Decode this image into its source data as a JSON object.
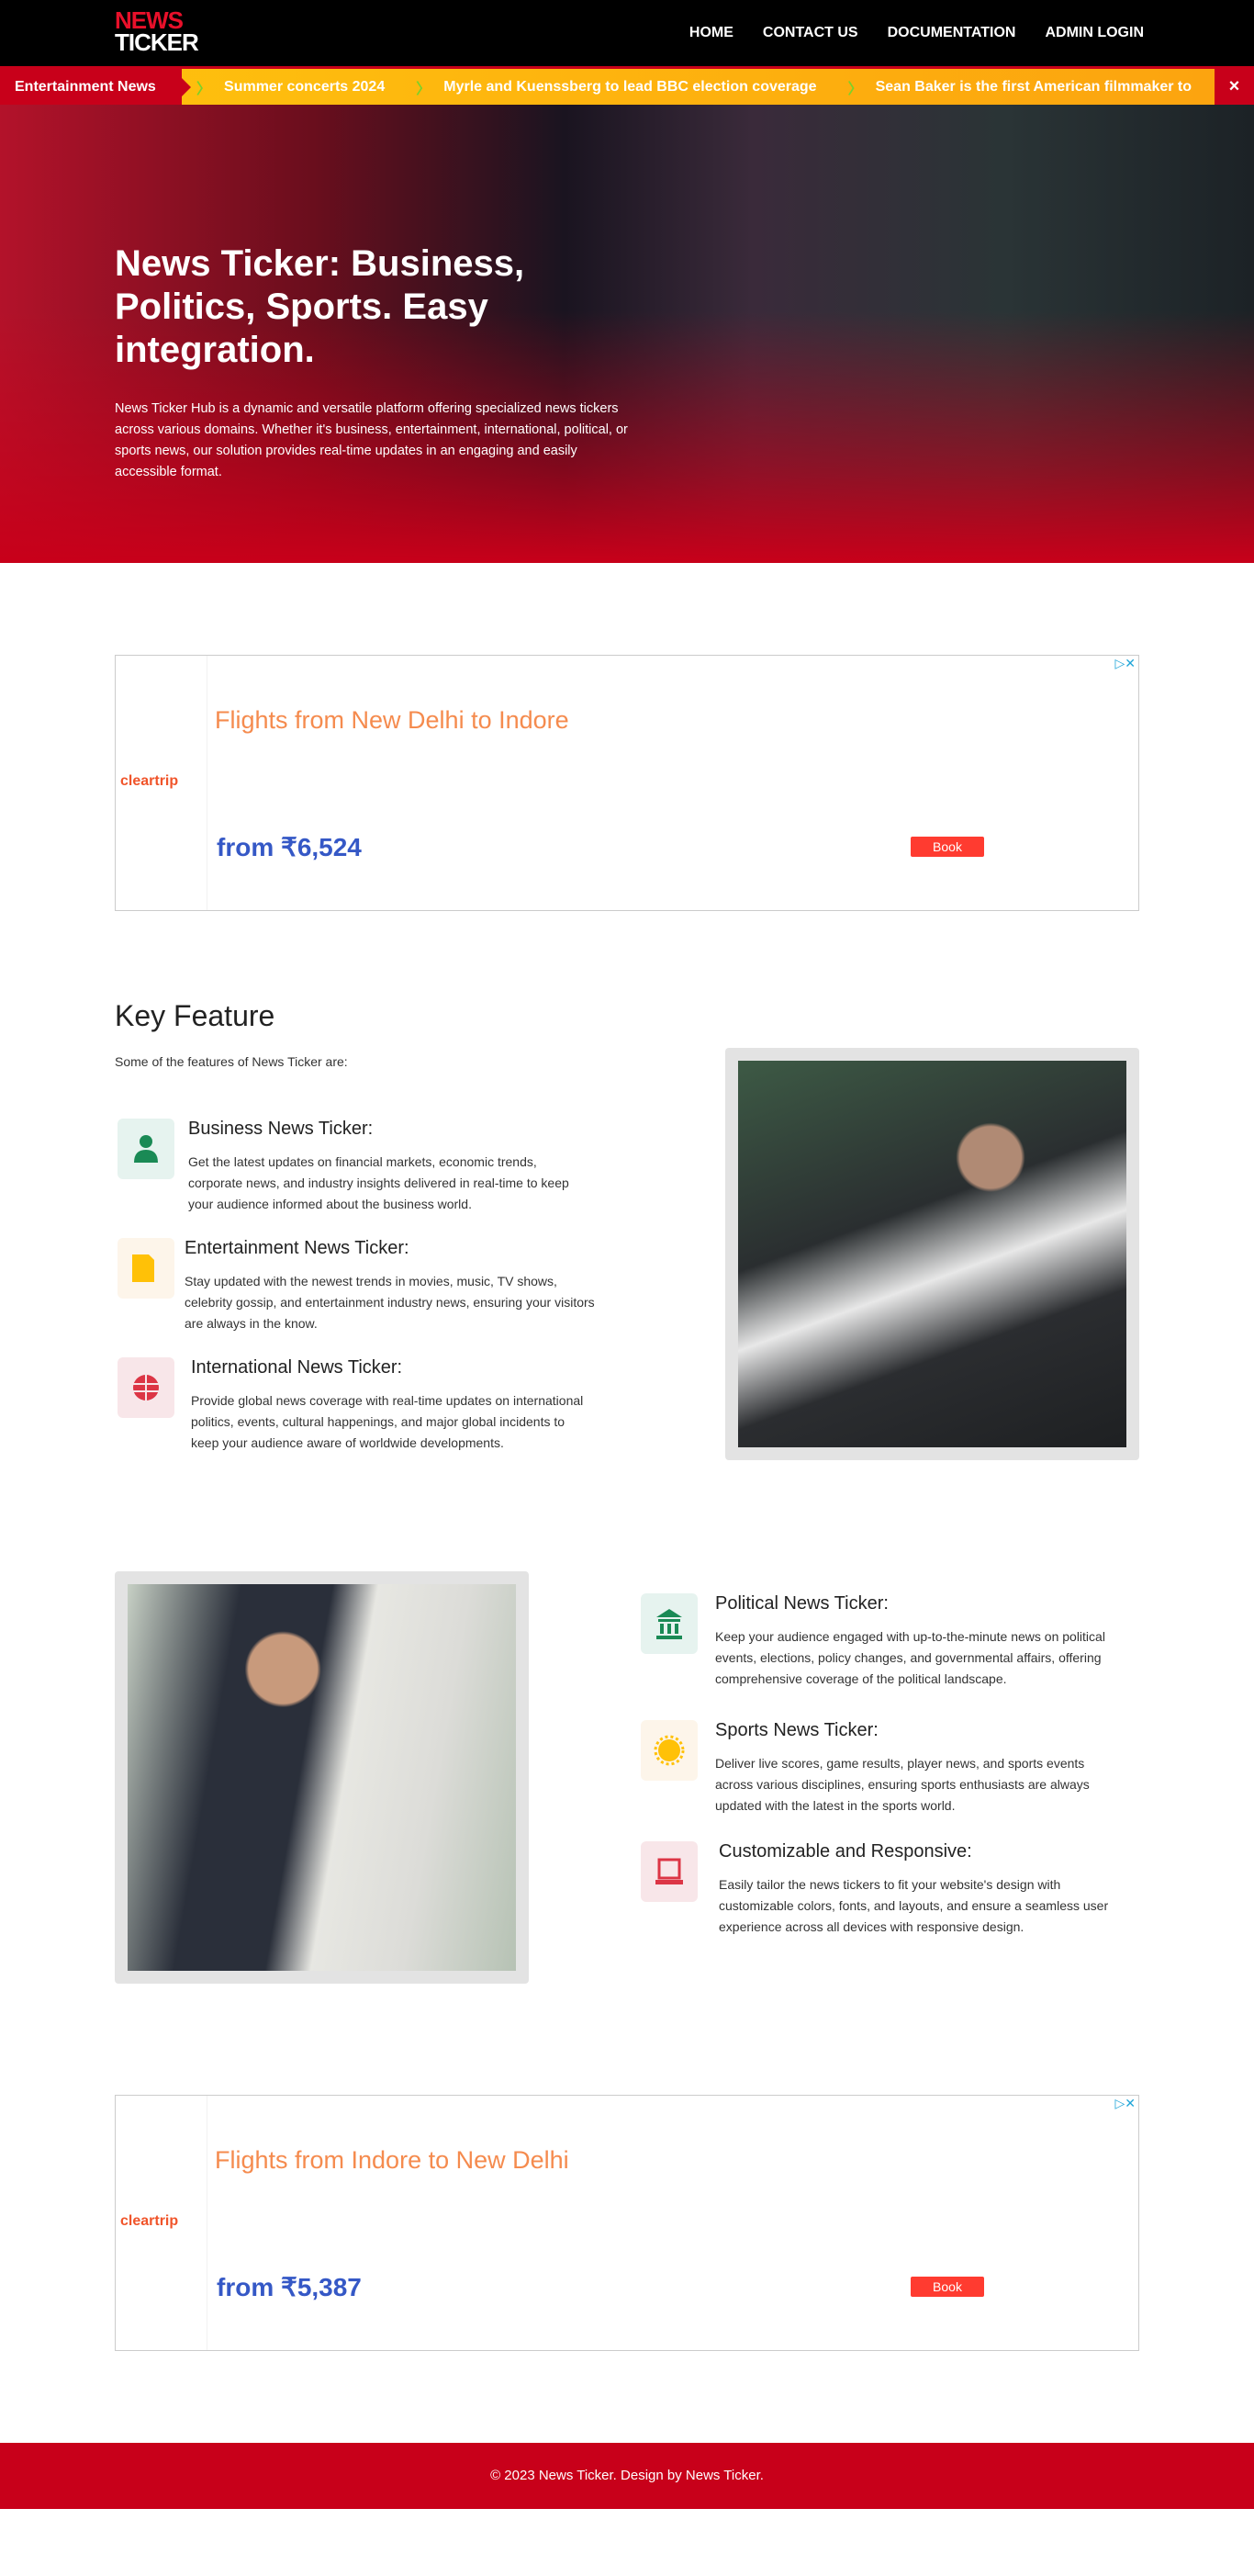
{
  "header": {
    "logo_line1": "NEWS",
    "logo_line2": "TICKER",
    "nav": [
      "HOME",
      "CONTACT US",
      "DOCUMENTATION",
      "ADMIN LOGIN"
    ]
  },
  "ticker": {
    "label": "Entertainment News",
    "items": [
      "Summer concerts 2024",
      "Myrle and Kuenssberg to lead BBC election coverage",
      "Sean Baker is the first American filmmaker to"
    ],
    "close": "×"
  },
  "hero": {
    "title": "News Ticker: Business, Politics, Sports. Easy integration.",
    "description": "News Ticker Hub is a dynamic and versatile platform offering specialized news tickers across various domains. Whether it's business, entertainment, international, political, or sports news, our solution provides real-time updates in an engaging and easily accessible format."
  },
  "ads": [
    {
      "brand": "cleartrip",
      "title": "Flights from New Delhi to Indore",
      "price": "from ₹6,524",
      "button": "Book",
      "choices": "▷✕"
    },
    {
      "brand": "cleartrip",
      "title": "Flights from Indore to New Delhi",
      "price": "from ₹5,387",
      "button": "Book",
      "choices": "▷✕"
    }
  ],
  "key_feature": {
    "title": "Key Feature",
    "subtitle": "Some of the features of News Ticker are:",
    "features": [
      {
        "title": "Business News Ticker:",
        "description": "Get the latest updates on financial markets, economic trends, corporate news, and industry insights delivered in real-time to keep your audience informed about the business world.",
        "icon": "user-icon",
        "color": "#1a8a55"
      },
      {
        "title": "Entertainment News Ticker:",
        "description": "Stay updated with the newest trends in movies, music, TV shows, celebrity gossip, and entertainment industry news, ensuring your visitors are always in the know.",
        "icon": "file-icon",
        "color": "#ffc107"
      },
      {
        "title": "International News Ticker:",
        "description": "Provide global news coverage with real-time updates on international politics, events, cultural happenings, and major global incidents to keep your audience aware of worldwide developments.",
        "icon": "globe-icon",
        "color": "#dc3545"
      },
      {
        "title": "Political News Ticker:",
        "description": "Keep your audience engaged with up-to-the-minute news on political events, elections, policy changes, and governmental affairs, offering comprehensive coverage of the political landscape.",
        "icon": "bank-icon",
        "color": "#1a8a55"
      },
      {
        "title": "Sports News Ticker:",
        "description": "Deliver live scores, game results, player news, and sports events across various disciplines, ensuring sports enthusiasts are always updated with the latest in the sports world.",
        "icon": "badge-icon",
        "color": "#ffc107"
      },
      {
        "title": "Customizable and Responsive:",
        "description": "Easily tailor the news tickers to fit your website's design with customizable colors, fonts, and layouts, and ensure a seamless user experience across all devices with responsive design.",
        "icon": "laptop-icon",
        "color": "#dc3545"
      }
    ]
  },
  "footer": {
    "text": "© 2023 News Ticker. Design by News Ticker."
  }
}
